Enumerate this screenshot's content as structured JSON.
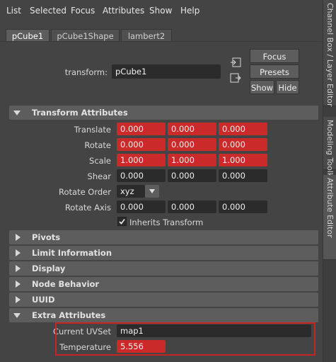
{
  "menu": [
    "List",
    "Selected",
    "Focus",
    "Attributes",
    "Show",
    "Help"
  ],
  "tabs": [
    "pCube1",
    "pCube1Shape",
    "lambert2"
  ],
  "transform": {
    "label": "transform:",
    "value": "pCube1"
  },
  "buttons": {
    "focus": "Focus",
    "presets": "Presets",
    "show": "Show",
    "hide": "Hide"
  },
  "sections": {
    "transform_attributes": "Transform Attributes",
    "pivots": "Pivots",
    "limit_information": "Limit Information",
    "display": "Display",
    "node_behavior": "Node Behavior",
    "uuid": "UUID",
    "extra_attributes": "Extra Attributes"
  },
  "attrs": {
    "translate": {
      "label": "Translate",
      "x": "0.000",
      "y": "0.000",
      "z": "0.000"
    },
    "rotate": {
      "label": "Rotate",
      "x": "0.000",
      "y": "0.000",
      "z": "0.000"
    },
    "scale": {
      "label": "Scale",
      "x": "1.000",
      "y": "1.000",
      "z": "1.000"
    },
    "shear": {
      "label": "Shear",
      "x": "0.000",
      "y": "0.000",
      "z": "0.000"
    },
    "rotate_order": {
      "label": "Rotate Order",
      "value": "xyz"
    },
    "rotate_axis": {
      "label": "Rotate Axis",
      "x": "0.000",
      "y": "0.000",
      "z": "0.000"
    },
    "inherits_transform": {
      "label": "Inherits Transform",
      "checked": true
    }
  },
  "extra": {
    "current_uvset": {
      "label": "Current UVSet",
      "value": "map1"
    },
    "temperature": {
      "label": "Temperature",
      "value": "5.556"
    }
  },
  "side_tabs": [
    "Channel Box / Layer Editor",
    "Modeling Toolkit",
    "Attribute Editor"
  ],
  "colors": {
    "keyed_red": "#cb2a2a",
    "panel": "#444444",
    "field": "#2b2b2b",
    "highlight": "#c72424"
  }
}
